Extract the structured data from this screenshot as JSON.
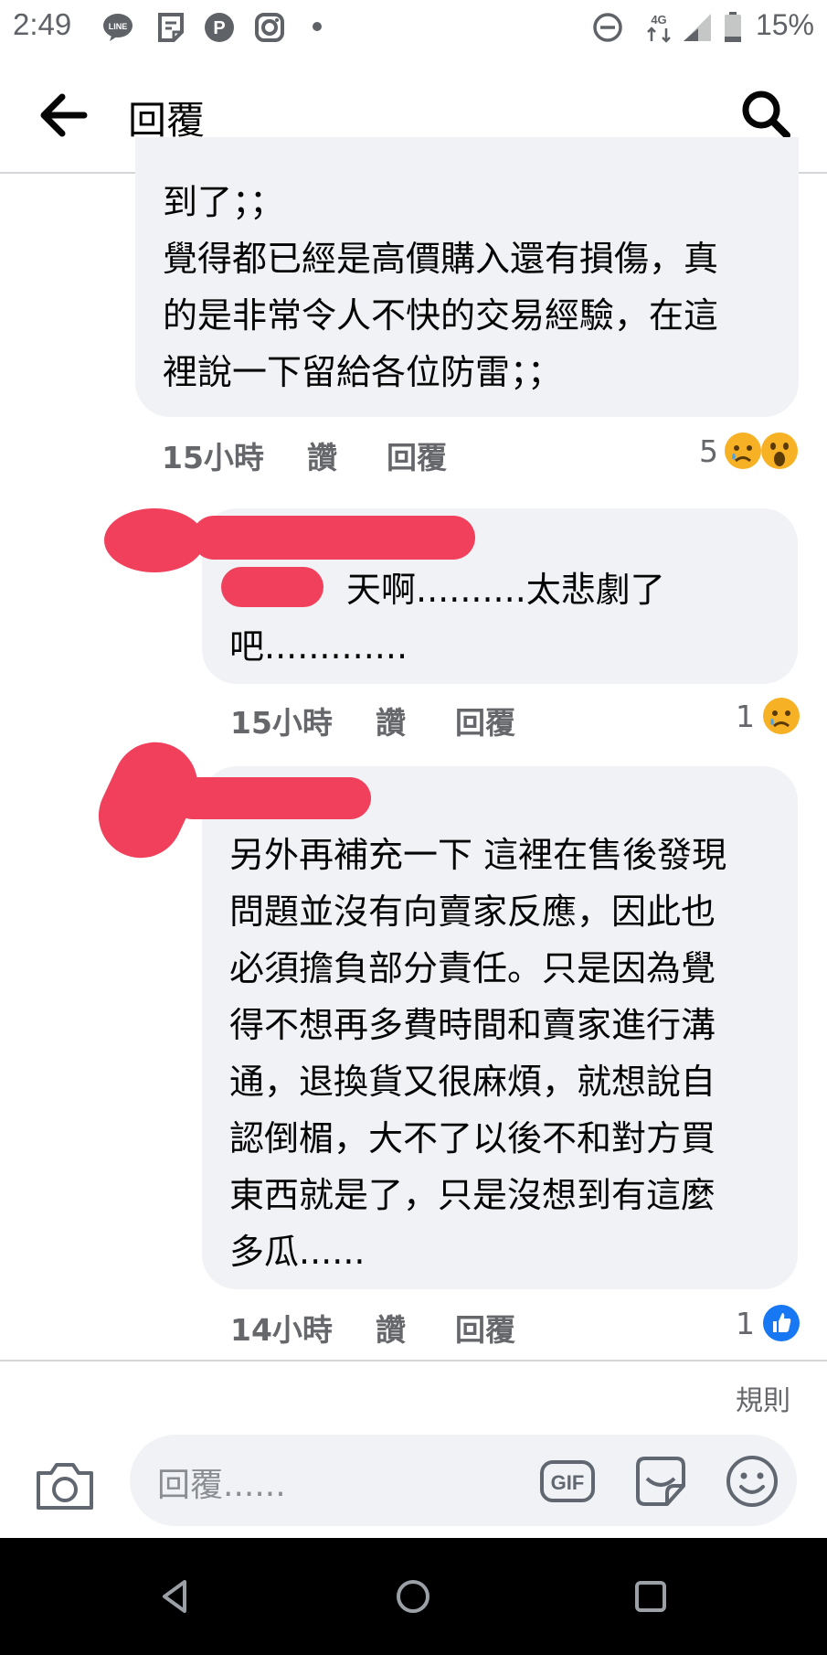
{
  "status_bar": {
    "time": "2:49",
    "battery": "15%",
    "network": "4G",
    "icons": [
      "line-icon",
      "notes-icon",
      "p-icon",
      "instagram-icon",
      "dot-icon",
      "dnd-icon",
      "network-icon",
      "signal-icon",
      "battery-icon"
    ]
  },
  "header": {
    "title": "回覆",
    "back_icon": "back-arrow-icon",
    "search_icon": "search-icon"
  },
  "comments": [
    {
      "text": "到了；；\n覺得都已經是高價購入還有損傷，真\n的是非常令人不快的交易經驗，在這\n裡說一下留給各位防雷；；",
      "time": "15小時",
      "like": "讚",
      "reply": "回覆",
      "reaction_count": "5",
      "reactions": [
        "sad-icon",
        "wow-icon"
      ]
    },
    {
      "text": "天啊..........太悲劇了\n吧.............",
      "time": "15小時",
      "like": "讚",
      "reply": "回覆",
      "reaction_count": "1",
      "reactions": [
        "sad-icon"
      ]
    },
    {
      "text": "另外再補充一下 這裡在售後發現\n問題並沒有向賣家反應，因此也\n必須擔負部分責任。只是因為覺\n得不想再多費時間和賣家進行溝\n通，退換貨又很麻煩，就想說自\n認倒楣，大不了以後不和對方買\n東西就是了，只是沒想到有這麼\n多瓜......",
      "time": "14小時",
      "like": "讚",
      "reply": "回覆",
      "reaction_count": "1",
      "reactions": [
        "like-icon"
      ]
    }
  ],
  "composer": {
    "rules": "規則",
    "placeholder": "回覆......",
    "gif": "GIF"
  },
  "colors": {
    "bubble": "#f0f2f5",
    "meta": "#65676b",
    "redaction": "#f0405c",
    "like_blue": "#1877f2",
    "emoji_yellow": "#f7b125"
  }
}
